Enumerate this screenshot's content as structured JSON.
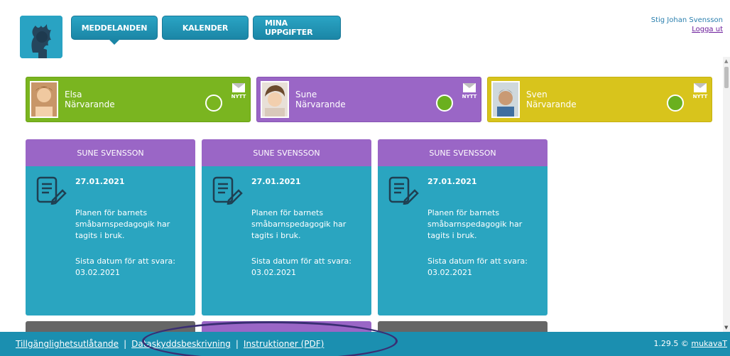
{
  "nav": {
    "tabs": [
      "MEDDELANDEN",
      "KALENDER",
      "MINA UPPGIFTER"
    ]
  },
  "user": {
    "name": "Stig Johan Svensson",
    "logout": "Logga ut"
  },
  "children": [
    {
      "name": "Elsa",
      "status": "Närvarande",
      "badge": "NYTT",
      "color": "#7ab520"
    },
    {
      "name": "Sune",
      "status": "Närvarande",
      "badge": "NYTT",
      "color": "#9a66c6"
    },
    {
      "name": "Sven",
      "status": "Närvarande",
      "badge": "NYTT",
      "color": "#d8c41c"
    }
  ],
  "cards": [
    {
      "sender": "SUNE SVENSSON",
      "date": "27.01.2021",
      "message": "Planen för barnets småbarnspedagogik har tagits i bruk.",
      "due": "Sista datum för att svara: 03.02.2021"
    },
    {
      "sender": "SUNE SVENSSON",
      "date": "27.01.2021",
      "message": "Planen för barnets småbarnspedagogik har tagits i bruk.",
      "due": "Sista datum för att svara: 03.02.2021"
    },
    {
      "sender": "SUNE SVENSSON",
      "date": "27.01.2021",
      "message": "Planen för barnets småbarnspedagogik har tagits i bruk.",
      "due": "Sista datum för att svara: 03.02.2021"
    }
  ],
  "footer": {
    "links": [
      "Tillgänglighetsutlåtande",
      "Dataskyddsbeskrivning",
      "Instruktioner (PDF)"
    ],
    "version": "1.29.5 ©",
    "brand": "mukavaT"
  },
  "colors": {
    "primary": "#2aa4c4",
    "card_head": "#9a66c6",
    "card_body": "#2aa5c0",
    "footer": "#1b8fb0"
  }
}
